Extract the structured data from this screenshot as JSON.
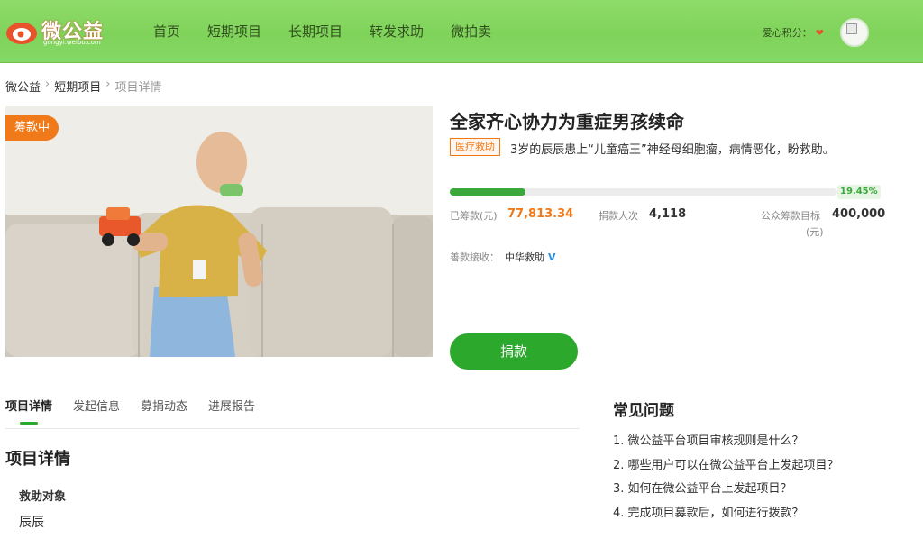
{
  "header": {
    "logo_text": "微公益",
    "logo_sub": "gongyi.weibo.com",
    "nav": [
      "首页",
      "短期项目",
      "长期项目",
      "转发求助",
      "微拍卖"
    ],
    "love_label": "爱心积分：",
    "brand_color": "#7fd35a"
  },
  "breadcrumb": [
    "微公益",
    "短期项目",
    "项目详情"
  ],
  "project": {
    "status_badge": "筹款中",
    "title": "全家齐心协力为重症男孩续命",
    "tag": "医疗救助",
    "summary": "3岁的辰辰患上“儿童癌王”神经母细胞瘤，病情恶化，盼救助。",
    "progress_percent": 19.45,
    "progress_label": "19.45%",
    "raised_label": "已筹款(元)",
    "raised_value": "77,813.34",
    "donors_label": "捐款人次",
    "donors_value": "4,118",
    "target_label": "公众筹款目标",
    "target_unit": "(元)",
    "target_value": "400,000",
    "receiver_label": "善款接收：",
    "receiver_org": "中华救助",
    "donate_button": "捐款"
  },
  "tabs": [
    "项目详情",
    "发起信息",
    "募捐动态",
    "进展报告"
  ],
  "detail": {
    "heading": "项目详情",
    "subheading": "救助对象",
    "name": "辰辰"
  },
  "faq": {
    "heading": "常见问题",
    "items": [
      "1. 微公益平台项目审核规则是什么？",
      "2. 哪些用户可以在微公益平台上发起项目？",
      "3. 如何在微公益平台上发起项目？",
      "4. 完成项目募款后，如何进行拨款？"
    ]
  }
}
